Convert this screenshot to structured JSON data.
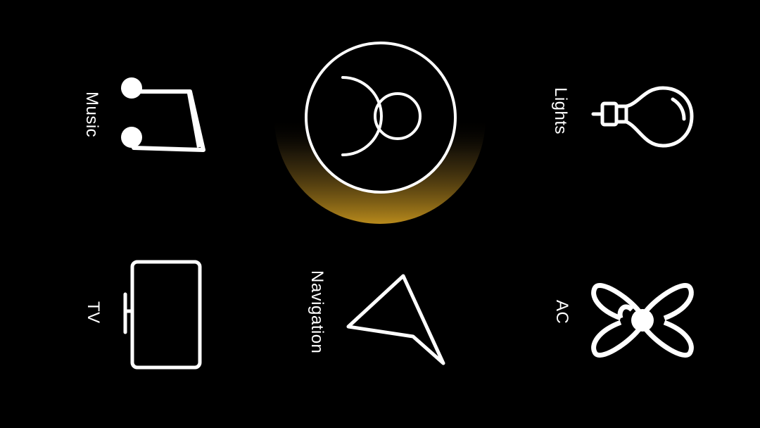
{
  "colors": {
    "background": "#000000",
    "foreground": "#ffffff",
    "accent_glow": "#b88a1c"
  },
  "center": {
    "icon": "assistant-logo-icon"
  },
  "tiles": {
    "music": {
      "label": "Music",
      "icon": "music-note-icon"
    },
    "lights": {
      "label": "Lights",
      "icon": "light-bulb-icon"
    },
    "tv": {
      "label": "TV",
      "icon": "tv-icon"
    },
    "navigation": {
      "label": "Navigation",
      "icon": "navigation-arrow-icon"
    },
    "ac": {
      "label": "AC",
      "icon": "fan-icon"
    }
  }
}
